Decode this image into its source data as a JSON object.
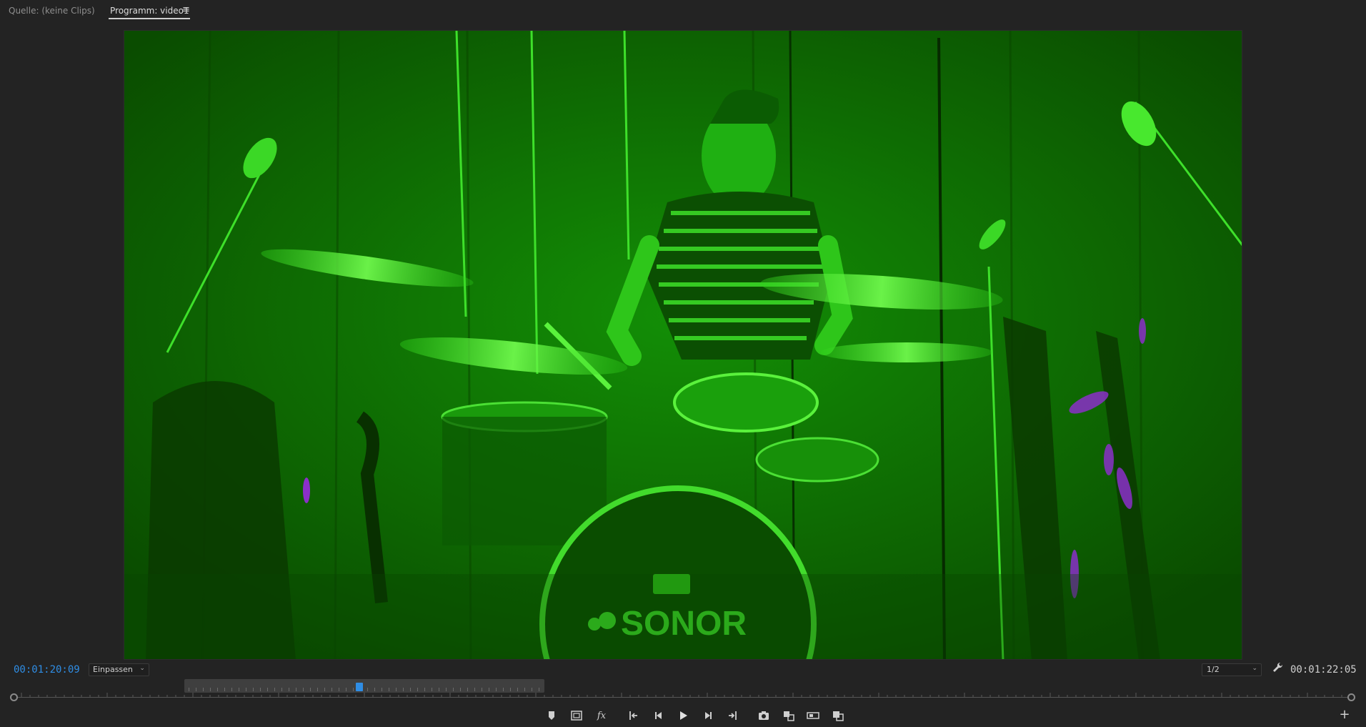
{
  "tabs": {
    "source": "Quelle: (keine Clips)",
    "program": "Programm: video1",
    "menu_icon": "hamburger-menu-icon"
  },
  "viewer": {
    "bass_drum_logo": "SONOR",
    "tint_color": "#1fbf12",
    "accent_purple": "#8b2fc9"
  },
  "timecode": {
    "current": "00:01:20:09",
    "duration": "00:01:22:05"
  },
  "zoom": {
    "selected": "Einpassen"
  },
  "resolution": {
    "selected": "1/2"
  },
  "playhead_position": 0.48,
  "colors": {
    "timecode_blue": "#2f8de4",
    "background": "#232323"
  },
  "transport": {
    "buttons": [
      "add-marker-icon",
      "safe-margins-icon",
      "fx-icon",
      "mark-in-icon",
      "step-back-icon",
      "play-icon",
      "step-forward-icon",
      "mark-out-icon",
      "export-frame-icon",
      "insert-icon",
      "overwrite-icon",
      "comparison-view-icon"
    ],
    "fx_label": "fx",
    "add_icon": "plus-icon"
  }
}
